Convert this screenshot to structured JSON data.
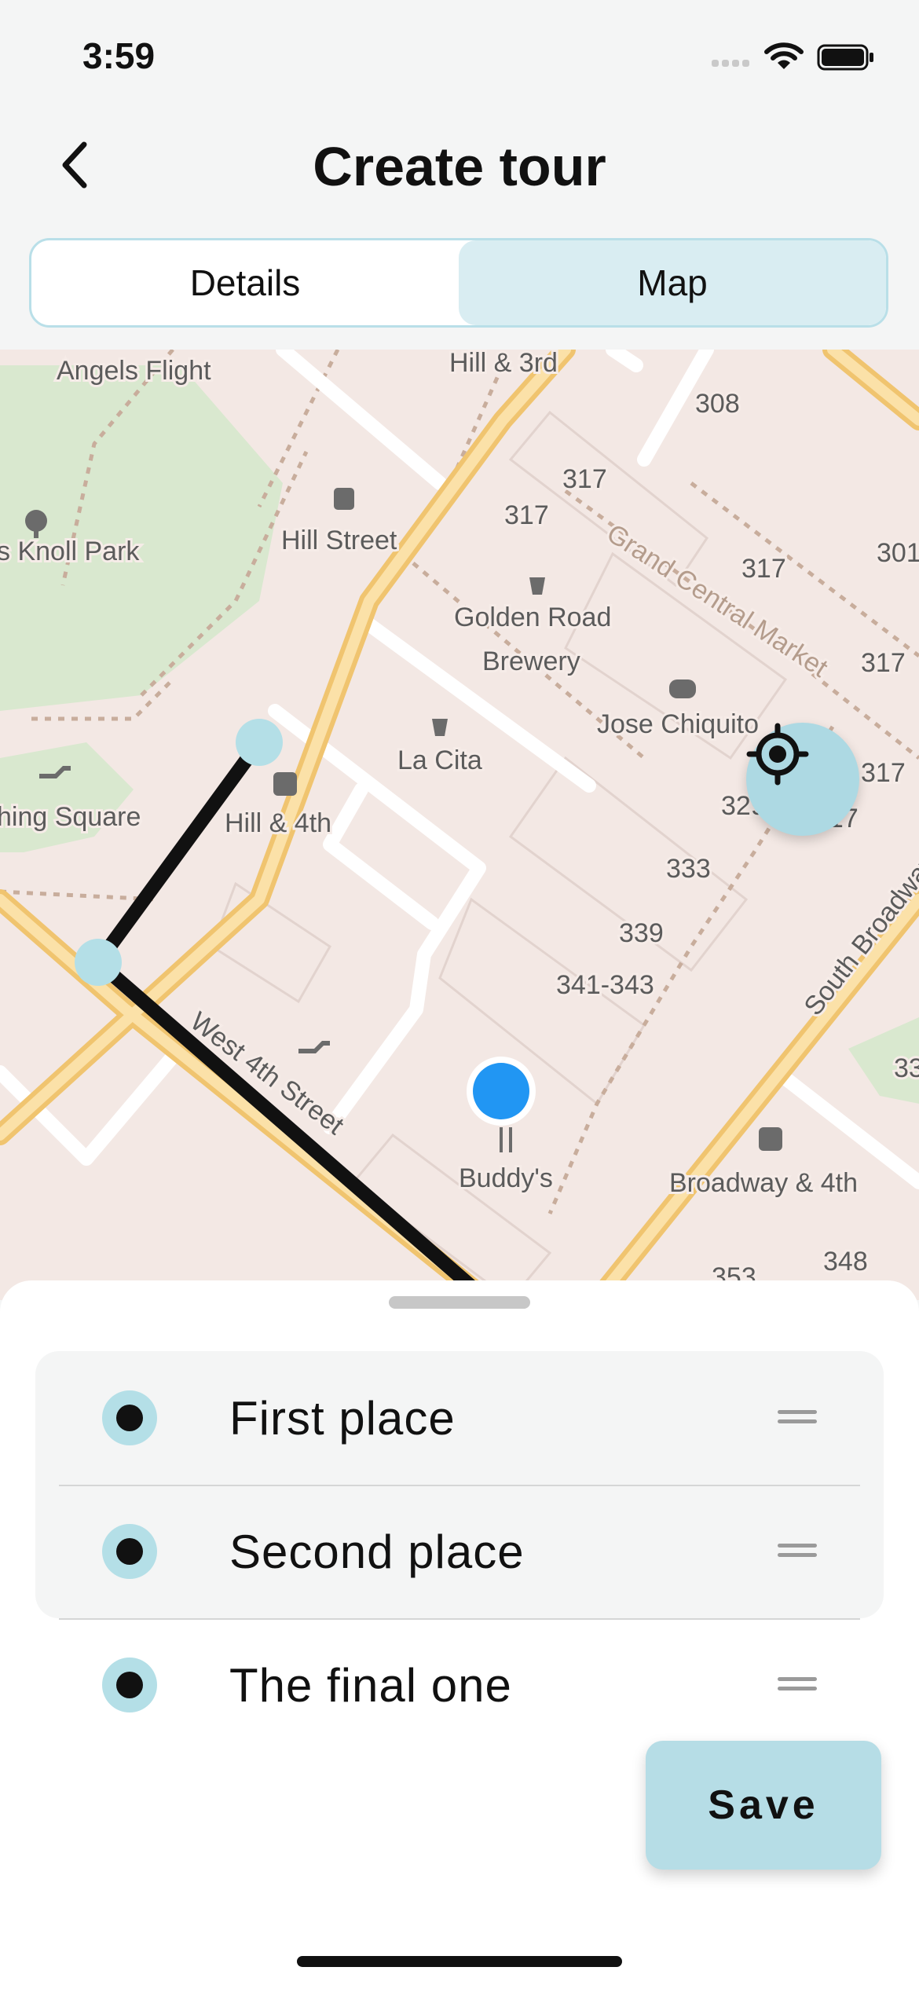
{
  "status_bar": {
    "time": "3:59"
  },
  "header": {
    "title": "Create tour",
    "back_icon": "chevron-left-icon"
  },
  "tabs": [
    {
      "label": "Details",
      "active": false
    },
    {
      "label": "Map",
      "active": true
    }
  ],
  "map": {
    "labels": {
      "angels_flight": "Angels Flight",
      "hill_3rd": "Hill & 3rd",
      "n308": "308",
      "n317a": "317",
      "n317b": "317",
      "knoll_park": "s Knoll Park",
      "hill_street": "Hill Street",
      "grand_central": "Grand Central Market",
      "n317c": "317",
      "n301": "301",
      "golden_road": "Golden Road",
      "brewery": "Brewery",
      "n317d": "317",
      "jose": "Jose Chiquito",
      "la_cita": "La Cita",
      "n317e": "317",
      "hing_square": "hing Square",
      "n329": "329",
      "n317f": "317",
      "hill_4th": "Hill & 4th",
      "n333": "333",
      "south_broadway": "South Broadway",
      "n339": "339",
      "n341": "341-343",
      "west_4th": "West 4th Street",
      "n33": "33",
      "buddys": "Buddy's",
      "broadway_4th": "Broadway & 4th",
      "n348": "348",
      "n353": "353"
    },
    "locate_icon": "crosshair-icon"
  },
  "places": [
    {
      "name": "First place"
    },
    {
      "name": "Second place"
    },
    {
      "name": "The final one"
    }
  ],
  "save_label": "Save",
  "colors": {
    "accent": "#b6dde6",
    "route": "#111111",
    "current_location": "#2196f3"
  }
}
